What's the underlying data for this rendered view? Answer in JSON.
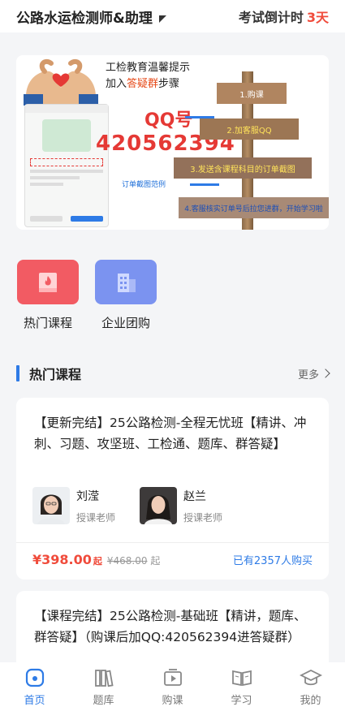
{
  "header": {
    "title": "公路水运检测师&助理",
    "countdown_label": "考试倒计时",
    "countdown_days": "3天"
  },
  "banner": {
    "tip_title": "工检教育温馨提示",
    "tip_sub_prefix": "加入",
    "tip_sub_highlight": "答疑群",
    "tip_sub_suffix": "步骤",
    "qq_label": "QQ号",
    "qq_number": "420562394",
    "order_example": "订单截图范例",
    "steps": [
      "1.购课",
      "2.加客服QQ",
      "3.发送含课程科目的订单截图",
      "4.客服核实订单号后拉您进群，开始学习啦"
    ]
  },
  "quick_entries": [
    {
      "label": "热门课程",
      "icon": "hot-book-icon"
    },
    {
      "label": "企业团购",
      "icon": "building-icon"
    }
  ],
  "section": {
    "title": "热门课程",
    "more": "更多"
  },
  "courses": [
    {
      "title": "【更新完结】25公路检测-全程无忧班【精讲、冲刺、习题、攻坚班、工检通、题库、群答疑】",
      "teachers": [
        {
          "name": "刘滢",
          "role": "授课老师"
        },
        {
          "name": "赵兰",
          "role": "授课老师"
        }
      ],
      "price": "¥398.00",
      "price_suffix": "起",
      "original_price": "¥468.00",
      "original_suffix": "起",
      "buyers": "已有2357人购买"
    },
    {
      "title": "【课程完结】25公路检测-基础班【精讲，题库、群答疑】（购课后加QQ:420562394进答疑群）"
    }
  ],
  "tabbar": [
    {
      "label": "首页",
      "icon": "home-icon",
      "active": true
    },
    {
      "label": "题库",
      "icon": "books-icon",
      "active": false
    },
    {
      "label": "购课",
      "icon": "video-icon",
      "active": false
    },
    {
      "label": "学习",
      "icon": "open-book-icon",
      "active": false
    },
    {
      "label": "我的",
      "icon": "graduation-cap-icon",
      "active": false
    }
  ],
  "colors": {
    "accent": "#2e7be6",
    "price": "#f04b3b",
    "hot_tile": "#f25b63",
    "group_tile": "#7b93f0"
  }
}
